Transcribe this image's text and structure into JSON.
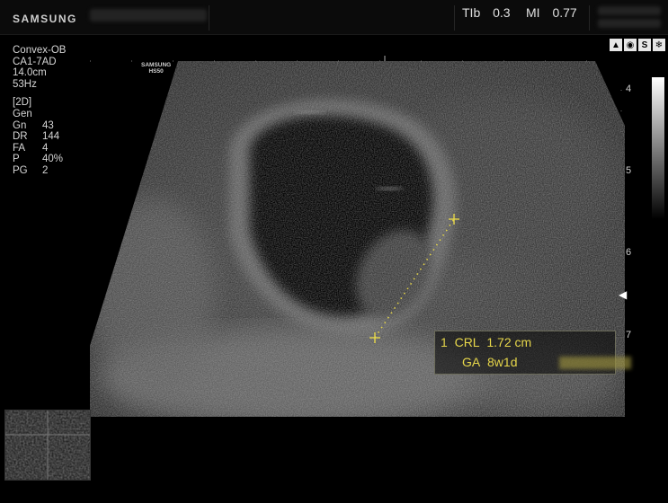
{
  "header": {
    "brand": "SAMSUNG",
    "tib_label": "TIb",
    "tib_value": "0.3",
    "mi_label": "MI",
    "mi_value": "0.77"
  },
  "probe": {
    "preset": "Convex-OB",
    "transducer": "CA1-7AD",
    "depth": "14.0cm",
    "frame_rate": "53Hz",
    "badge_line1": "SAMSUNG",
    "badge_line2": "HS50"
  },
  "imaging": {
    "mode": "[2D]",
    "harmonic": "Gen",
    "params": [
      {
        "key": "Gn",
        "value": "43"
      },
      {
        "key": "DR",
        "value": "144"
      },
      {
        "key": "FA",
        "value": "4"
      },
      {
        "key": "P",
        "value": "40%"
      },
      {
        "key": "PG",
        "value": "2"
      }
    ]
  },
  "depth_scale": [
    "4",
    "5",
    "6",
    "7"
  ],
  "status_icons": [
    "biopsy-icon",
    "fetus-icon",
    "s-icon",
    "snowflake-icon"
  ],
  "measurement": {
    "index": "1",
    "type": "CRL",
    "value": "1.72 cm",
    "ga_label": "GA",
    "ga_value": "8w1d"
  },
  "colors": {
    "caliper": "#e6d64a",
    "background": "#000000"
  }
}
